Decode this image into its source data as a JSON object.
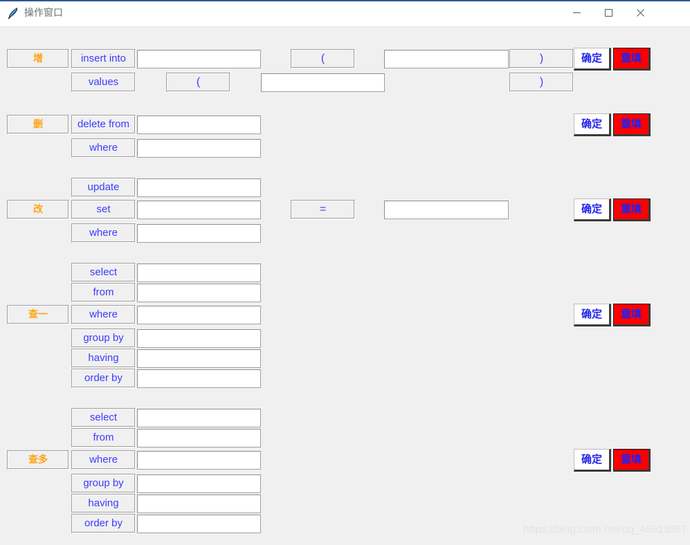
{
  "window": {
    "title": "操作窗口",
    "icon": "feather-icon",
    "controls": {
      "minimize": "minimize-icon",
      "maximize": "maximize-icon",
      "close": "close-icon"
    }
  },
  "buttons": {
    "confirm": "确定",
    "reset": "重填"
  },
  "sections": [
    {
      "id": "insert",
      "tag": "增",
      "keywords": [
        "insert into",
        "values"
      ],
      "symbols": [
        "(",
        ")",
        "(",
        ")"
      ],
      "fields": [
        "",
        "",
        "",
        ""
      ]
    },
    {
      "id": "delete",
      "tag": "删",
      "keywords": [
        "delete from",
        "where"
      ],
      "fields": [
        "",
        ""
      ]
    },
    {
      "id": "update",
      "tag": "改",
      "keywords": [
        "update",
        "set",
        "where"
      ],
      "symbols": [
        "="
      ],
      "fields": [
        "",
        "",
        "",
        ""
      ]
    },
    {
      "id": "select-one",
      "tag": "查一",
      "keywords": [
        "select",
        "from",
        "where",
        "group by",
        "having",
        "order by"
      ],
      "fields": [
        "",
        "",
        "",
        "",
        "",
        ""
      ]
    },
    {
      "id": "select-many",
      "tag": "查多",
      "keywords": [
        "select",
        "from",
        "where",
        "group by",
        "having",
        "order by"
      ],
      "fields": [
        "",
        "",
        "",
        "",
        "",
        ""
      ]
    }
  ],
  "watermark": "https://blog.csdn.net/qq_45913057",
  "colors": {
    "background": "#f0f0f0",
    "keyword_text": "#3b3bff",
    "tag_text": "#ffa517",
    "reset_button": "#fe0000",
    "titlebar": "#ffffff"
  }
}
